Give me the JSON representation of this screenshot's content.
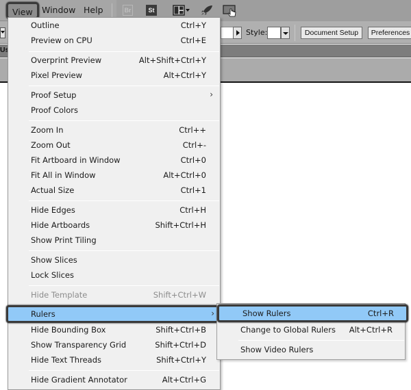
{
  "menubar": {
    "items": [
      {
        "label": "View",
        "active": true
      },
      {
        "label": "Window"
      },
      {
        "label": "Help"
      }
    ],
    "app_icons": [
      {
        "name": "bridge-icon",
        "label": "Br"
      },
      {
        "name": "stock-icon",
        "label": "St"
      },
      {
        "name": "arrange-documents-icon"
      },
      {
        "name": "gpu-performance-icon"
      },
      {
        "name": "touch-workspace-icon"
      }
    ]
  },
  "controlbar": {
    "style_label": "Style:",
    "document_setup_label": "Document Setup",
    "preferences_label": "Preferences"
  },
  "tabstrip": {
    "label": "Us"
  },
  "view_menu": {
    "groups": [
      [
        {
          "label": "Outline",
          "shortcut": "Ctrl+Y"
        },
        {
          "label": "Preview on CPU",
          "shortcut": "Ctrl+E"
        }
      ],
      [
        {
          "label": "Overprint Preview",
          "shortcut": "Alt+Shift+Ctrl+Y"
        },
        {
          "label": "Pixel Preview",
          "shortcut": "Alt+Ctrl+Y"
        }
      ],
      [
        {
          "label": "Proof Setup",
          "shortcut": "",
          "submenu": true
        },
        {
          "label": "Proof Colors",
          "shortcut": ""
        }
      ],
      [
        {
          "label": "Zoom In",
          "shortcut": "Ctrl++"
        },
        {
          "label": "Zoom Out",
          "shortcut": "Ctrl+-"
        },
        {
          "label": "Fit Artboard in Window",
          "shortcut": "Ctrl+0"
        },
        {
          "label": "Fit All in Window",
          "shortcut": "Alt+Ctrl+0"
        },
        {
          "label": "Actual Size",
          "shortcut": "Ctrl+1"
        }
      ],
      [
        {
          "label": "Hide Edges",
          "shortcut": "Ctrl+H"
        },
        {
          "label": "Hide Artboards",
          "shortcut": "Shift+Ctrl+H"
        },
        {
          "label": "Show Print Tiling",
          "shortcut": ""
        }
      ],
      [
        {
          "label": "Show Slices",
          "shortcut": ""
        },
        {
          "label": "Lock Slices",
          "shortcut": ""
        }
      ],
      [
        {
          "label": "Hide Template",
          "shortcut": "Shift+Ctrl+W",
          "disabled": true
        }
      ],
      [
        {
          "label": "Rulers",
          "shortcut": "",
          "submenu": true,
          "highlighted": true
        },
        {
          "label": "Hide Bounding Box",
          "shortcut": "Shift+Ctrl+B"
        },
        {
          "label": "Show Transparency Grid",
          "shortcut": "Shift+Ctrl+D"
        },
        {
          "label": "Hide Text Threads",
          "shortcut": "Shift+Ctrl+Y"
        }
      ],
      [
        {
          "label": "Hide Gradient Annotator",
          "shortcut": "Alt+Ctrl+G"
        }
      ]
    ],
    "submenu_arrow": "›"
  },
  "rulers_submenu": {
    "items": [
      {
        "label": "Show Rulers",
        "shortcut": "Ctrl+R",
        "highlighted": true
      },
      {
        "label": "Change to Global Rulers",
        "shortcut": "Alt+Ctrl+R"
      },
      {
        "label": "Show Video Rulers",
        "shortcut": "",
        "separator_before": true
      }
    ]
  },
  "colors": {
    "highlight": "#91c9f7",
    "highlight_border": "#3a3a3a",
    "menu_bg": "#f0f0f0",
    "menubar_bg": "#a6a6a6"
  }
}
